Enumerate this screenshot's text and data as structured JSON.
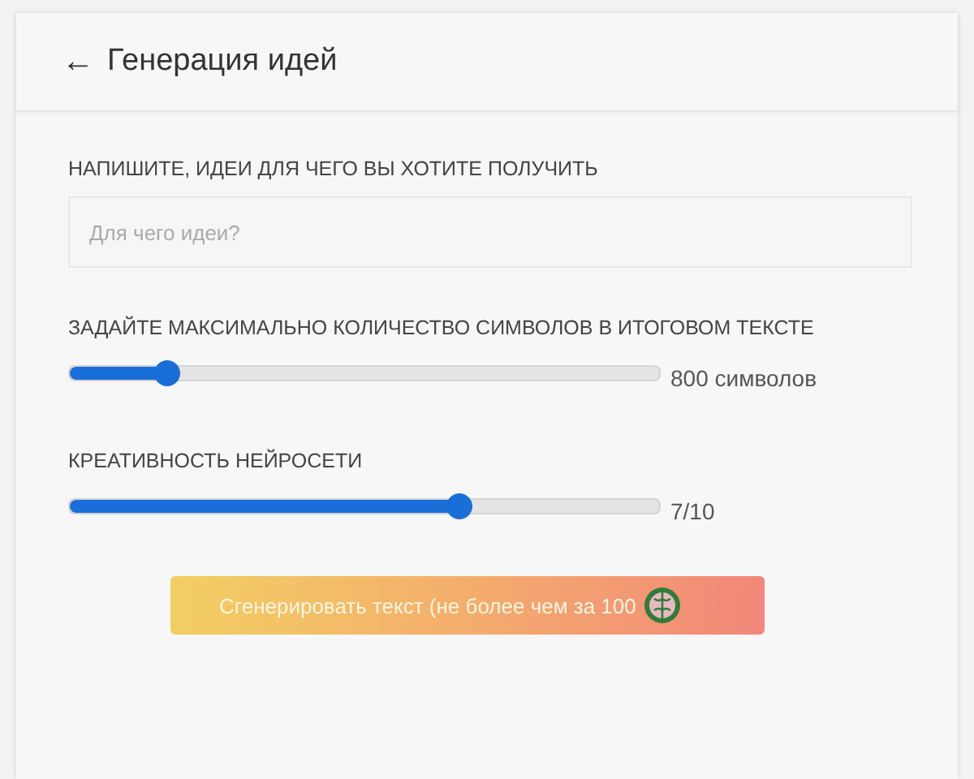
{
  "header": {
    "back_icon": "←",
    "title": "Генерация идей"
  },
  "idea_field": {
    "label": "НАПИШИТЕ, ИДЕИ ДЛЯ ЧЕГО ВЫ ХОТИТЕ ПОЛУЧИТЬ",
    "placeholder": "Для чего идеи?"
  },
  "sliders": [
    {
      "label": "ЗАДАЙТЕ МАКСИМАЛЬНО КОЛИЧЕСТВО СИМВОЛОВ В ИТОГОВОМ ТЕКСТЕ",
      "level": 0.165,
      "reading": "800 символов"
    },
    {
      "label": "КРЕАТИВНОСТЬ НЕЙРОСЕТИ",
      "level": 0.66,
      "reading": "7/10"
    }
  ],
  "generate_button": {
    "label": "Сгенерировать текст (не более чем за 100"
  }
}
